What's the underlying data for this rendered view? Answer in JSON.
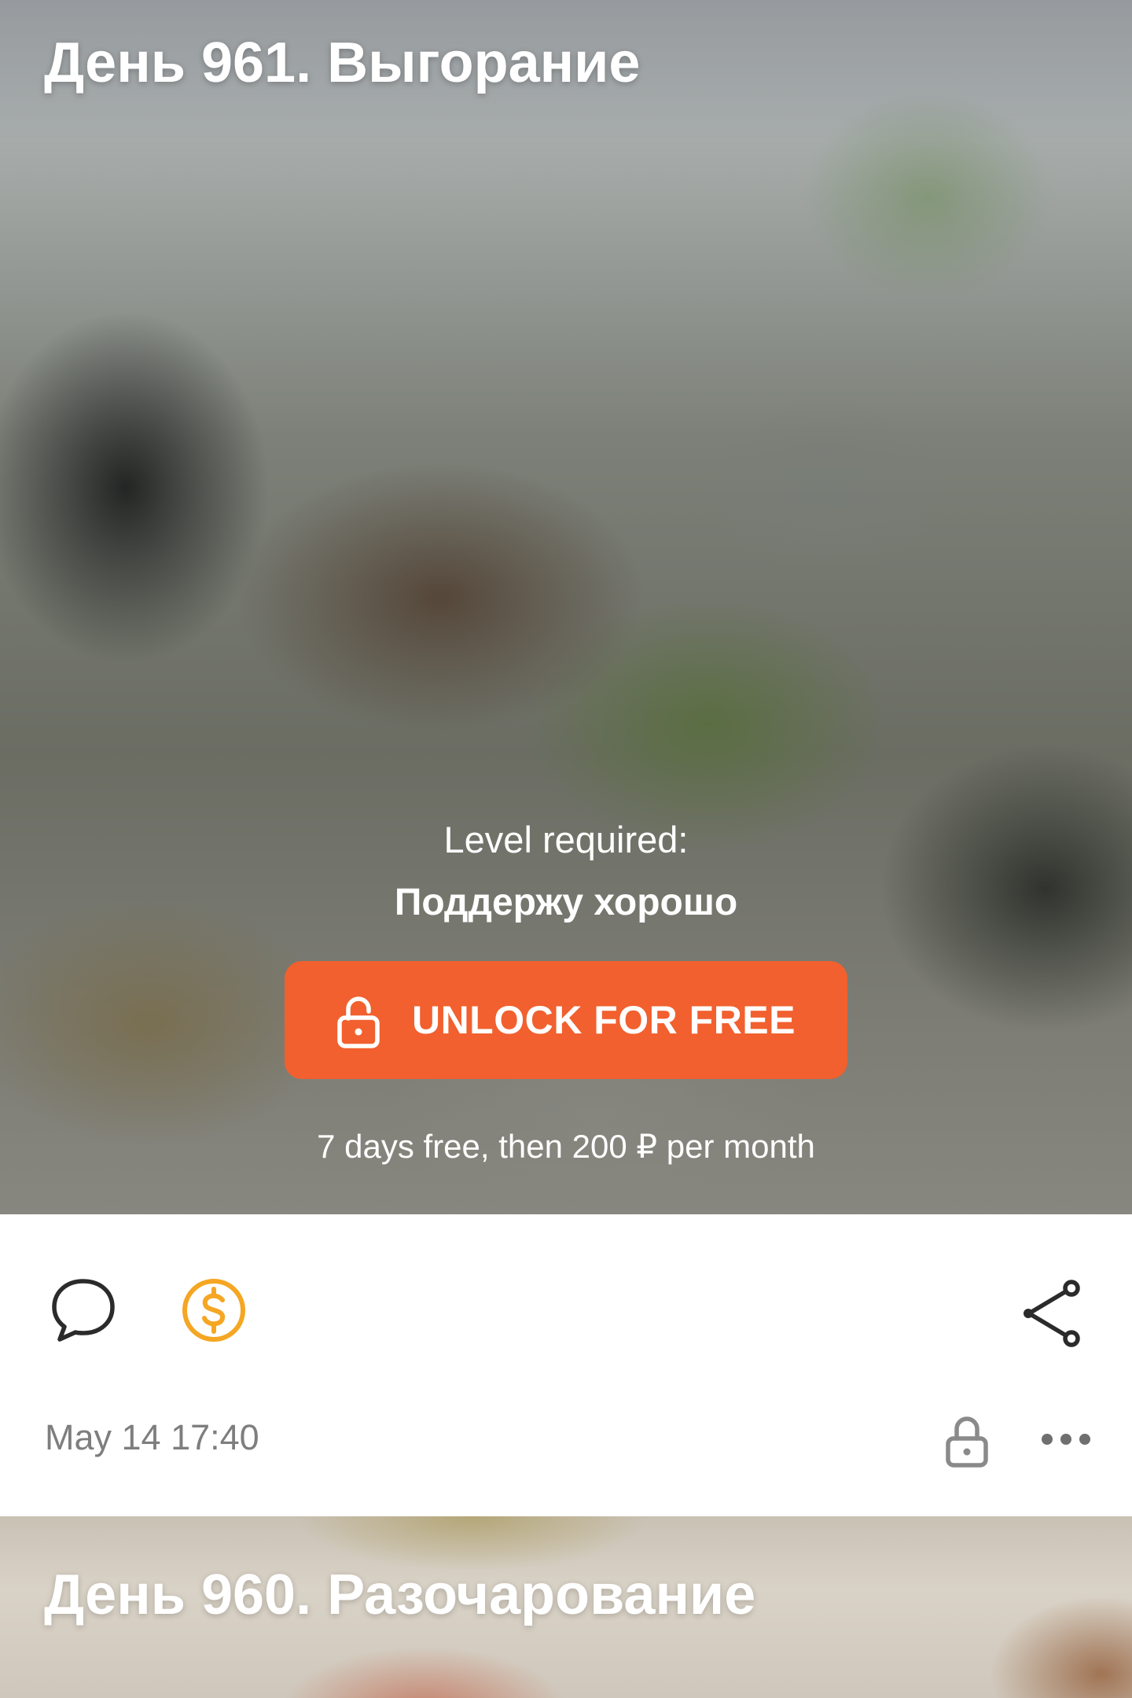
{
  "post": {
    "title": "День 961. Выгорание",
    "lock": {
      "level_label": "Level required:",
      "level_name": "Поддержу хорошо",
      "unlock_button_label": "UNLOCK FOR FREE",
      "trial_text": "7 days free, then 200 ₽ per month"
    },
    "actions": {
      "comment_icon": "speech-bubble-icon",
      "tip_icon": "dollar-coin-icon",
      "share_icon": "share-icon"
    },
    "date": "May 14 17:40",
    "lock_icon": "padlock-icon",
    "more_icon": "more-horizontal-icon"
  },
  "next_post": {
    "title": "День 960. Разочарование"
  },
  "colors": {
    "accent": "#f1602e",
    "tip_icon": "#f5a623",
    "muted_text": "#7e7e7e",
    "icon_dark": "#2b2b2b"
  }
}
